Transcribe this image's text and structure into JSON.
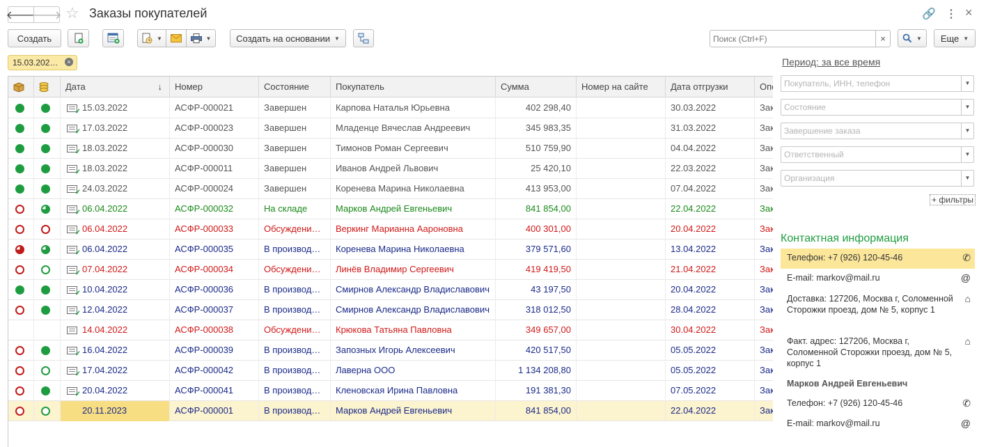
{
  "window": {
    "title": "Заказы покупателей",
    "back_glyph": "🡐",
    "forward_glyph": "🡒",
    "star_glyph": "☆",
    "link_glyph": "🔗",
    "menu_glyph": "⋮",
    "close_glyph": "×"
  },
  "toolbar": {
    "create_label": "Создать",
    "create_based_label": "Создать на основании",
    "search_placeholder": "Поиск (Ctrl+F)",
    "search_clear": "×",
    "search_btn_glyph": "🔍",
    "more_label": "Еще"
  },
  "filter_chip": {
    "label": "15.03.202…",
    "remove_glyph": "×"
  },
  "table": {
    "columns": [
      "",
      "",
      "Дата",
      "Номер",
      "Состояние",
      "Покупатель",
      "Сумма",
      "Номер на сайте",
      "Дата отгрузки",
      "Опе"
    ],
    "sort_glyph": "↓",
    "rows": [
      {
        "pay": "full",
        "ship": "full",
        "doc": "ok",
        "date": "15.03.2022",
        "num": "АСФР-000021",
        "state": "Завершен",
        "buyer": "Карпова Наталья Юрьевна",
        "sum": "402 298,40",
        "site": "",
        "ship_date": "30.03.2022",
        "op": "Зак",
        "color": "#555555"
      },
      {
        "pay": "full",
        "ship": "full",
        "doc": "ok",
        "date": "17.03.2022",
        "num": "АСФР-000023",
        "state": "Завершен",
        "buyer": "Младенце Вячеслав Андреевич",
        "sum": "345 983,35",
        "site": "",
        "ship_date": "31.03.2022",
        "op": "Зак",
        "color": "#555555"
      },
      {
        "pay": "full",
        "ship": "full",
        "doc": "ok",
        "date": "18.03.2022",
        "num": "АСФР-000030",
        "state": "Завершен",
        "buyer": "Тимонов Роман Сергеевич",
        "sum": "510 759,90",
        "site": "",
        "ship_date": "04.04.2022",
        "op": "Зак",
        "color": "#555555"
      },
      {
        "pay": "full",
        "ship": "full",
        "doc": "ok",
        "date": "18.03.2022",
        "num": "АСФР-000011",
        "state": "Завершен",
        "buyer": "Иванов Андрей Львович",
        "sum": "25 420,10",
        "site": "",
        "ship_date": "22.03.2022",
        "op": "Зак",
        "color": "#555555"
      },
      {
        "pay": "full",
        "ship": "full",
        "doc": "ok",
        "date": "24.03.2022",
        "num": "АСФР-000024",
        "state": "Завершен",
        "buyer": "Коренева Марина Николаевна",
        "sum": "413 953,00",
        "site": "",
        "ship_date": "07.04.2022",
        "op": "Зак",
        "color": "#555555"
      },
      {
        "pay": "ring-red",
        "ship": "pie-green",
        "doc": "ok",
        "date": "06.04.2022",
        "num": "АСФР-000032",
        "state": "На складе",
        "buyer": "Марков Андрей Евгеньевич",
        "sum": "841 854,00",
        "site": "",
        "ship_date": "22.04.2022",
        "op": "Зак",
        "color": "#1a8a1a"
      },
      {
        "pay": "ring-red",
        "ship": "ring-red",
        "doc": "ok",
        "date": "06.04.2022",
        "num": "АСФР-000033",
        "state": "Обсуждени…",
        "buyer": "Веркинг Марианна Аароновна",
        "sum": "400 301,00",
        "site": "",
        "ship_date": "20.04.2022",
        "op": "Зак",
        "color": "#d01818"
      },
      {
        "pay": "pie-red",
        "ship": "pie-green",
        "doc": "ok",
        "date": "06.04.2022",
        "num": "АСФР-000035",
        "state": "В производ…",
        "buyer": "Коренева Марина Николаевна",
        "sum": "379 571,60",
        "site": "",
        "ship_date": "13.04.2022",
        "op": "Зак",
        "color": "#1a2a88"
      },
      {
        "pay": "ring-red",
        "ship": "ring-green",
        "doc": "ok",
        "date": "07.04.2022",
        "num": "АСФР-000034",
        "state": "Обсуждени…",
        "buyer": "Линёв Владимир Сергеевич",
        "sum": "419 419,50",
        "site": "",
        "ship_date": "21.04.2022",
        "op": "Зак",
        "color": "#d01818"
      },
      {
        "pay": "full",
        "ship": "full",
        "doc": "ok",
        "date": "10.04.2022",
        "num": "АСФР-000036",
        "state": "В производ…",
        "buyer": "Смирнов Александр Владиславович",
        "sum": "43 197,50",
        "site": "",
        "ship_date": "20.04.2022",
        "op": "Зак",
        "color": "#1a2a88"
      },
      {
        "pay": "ring-red",
        "ship": "full",
        "doc": "ok",
        "date": "12.04.2022",
        "num": "АСФР-000037",
        "state": "В производ…",
        "buyer": "Смирнов Александр Владиславович",
        "sum": "318 012,50",
        "site": "",
        "ship_date": "28.04.2022",
        "op": "Зак",
        "color": "#1a2a88"
      },
      {
        "pay": "",
        "ship": "",
        "doc": "plain",
        "date": "14.04.2022",
        "num": "АСФР-000038",
        "state": "Обсуждени…",
        "buyer": "Крюкова Татьяна Павловна",
        "sum": "349 657,00",
        "site": "",
        "ship_date": "30.04.2022",
        "op": "Зак",
        "color": "#d01818"
      },
      {
        "pay": "ring-red",
        "ship": "full",
        "doc": "ok",
        "date": "16.04.2022",
        "num": "АСФР-000039",
        "state": "В производ…",
        "buyer": "Запозных Игорь Алексеевич",
        "sum": "420 517,50",
        "site": "",
        "ship_date": "05.05.2022",
        "op": "Зак",
        "color": "#1a2a88"
      },
      {
        "pay": "ring-red",
        "ship": "ring-green",
        "doc": "ok",
        "date": "17.04.2022",
        "num": "АСФР-000042",
        "state": "В производ…",
        "buyer": "Лаверна ООО",
        "sum": "1 134 208,80",
        "site": "",
        "ship_date": "05.05.2022",
        "op": "Зак",
        "color": "#1a2a88"
      },
      {
        "pay": "ring-red",
        "ship": "full",
        "doc": "ok",
        "date": "20.04.2022",
        "num": "АСФР-000041",
        "state": "В производ…",
        "buyer": "Кленовская Ирина Павловна",
        "sum": "191 381,30",
        "site": "",
        "ship_date": "07.05.2022",
        "op": "Зак",
        "color": "#1a2a88"
      },
      {
        "pay": "ring-red",
        "ship": "ring-green",
        "doc": "ok",
        "date": "20.11.2023",
        "num": "АСФР-000001",
        "state": "В производ…",
        "buyer": "Марков Андрей Евгеньевич",
        "sum": "841 854,00",
        "site": "",
        "ship_date": "22.04.2022",
        "op": "Зак",
        "color": "#1a2a88"
      }
    ]
  },
  "right_panel": {
    "period": "Период: за все время",
    "filters": [
      "Покупатель, ИНН, телефон",
      "Состояние",
      "Завершение заказа",
      "Ответственный",
      "Организация"
    ],
    "more_filters": "+ фильтры",
    "contact_title": "Контактная информация",
    "contacts": [
      {
        "text": "Телефон: +7 (926) 120-45-46",
        "icon": "phone-icon",
        "glyph": "✆"
      },
      {
        "text": "E-mail: markov@mail.ru",
        "icon": "at-icon",
        "glyph": "@"
      },
      {
        "text": "Доставка: 127206, Москва г, Соломенной Сторожки проезд, дом № 5, корпус 1",
        "icon": "house-icon",
        "glyph": "⌂"
      },
      {
        "text": "Факт. адрес: 127206, Москва г, Соломенной Сторожки проезд, дом № 5, корпус 1",
        "icon": "house-icon",
        "glyph": "⌂"
      }
    ],
    "person_name": "Марков Андрей Евгеньевич",
    "person_contacts": [
      {
        "text": "Телефон: +7 (926) 120-45-46",
        "icon": "phone-icon",
        "glyph": "✆"
      },
      {
        "text": "E-mail: markov@mail.ru",
        "icon": "at-icon",
        "glyph": "@"
      }
    ]
  },
  "colors": {
    "accent_green": "#1e9c40",
    "status_red": "#c01a1a",
    "highlight_yellow": "#fbe69a",
    "selected_row": "#fcf3cf"
  }
}
